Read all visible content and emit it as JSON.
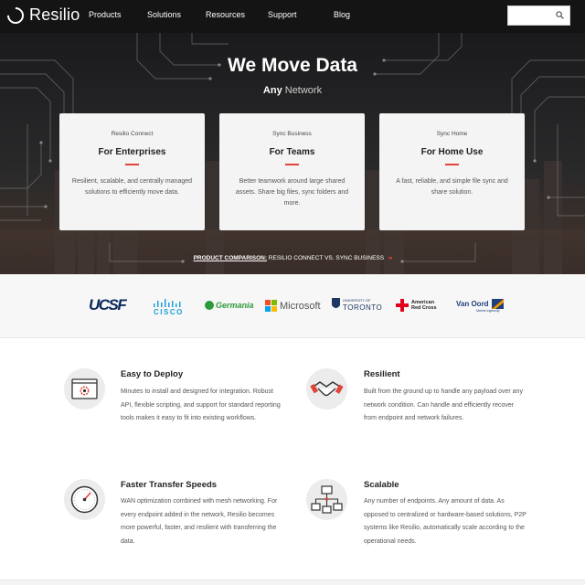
{
  "brand": {
    "name": "Resilio"
  },
  "nav": {
    "items": [
      {
        "label": "Products"
      },
      {
        "label": "Solutions"
      },
      {
        "label": "Resources"
      },
      {
        "label": "Support"
      },
      {
        "label": "Blog"
      }
    ]
  },
  "search": {
    "value": "",
    "placeholder": ""
  },
  "hero": {
    "title": "We Move Data",
    "subtitle_bold": "Any",
    "subtitle_light": "Network"
  },
  "cards": [
    {
      "kicker": "Resilio Connect",
      "title": "For Enterprises",
      "description": "Resilient, scalable, and centrally managed solutions to efficiently move data."
    },
    {
      "kicker": "Sync Business",
      "title": "For Teams",
      "description": "Better teamwork around large shared assets. Share big files, sync folders and more."
    },
    {
      "kicker": "Sync Home",
      "title": "For Home Use",
      "description": "A fast, reliable, and simple file sync and share solution."
    }
  ],
  "comparison": {
    "label": "PRODUCT COMPARISON:",
    "text": "RESILIO CONNECT VS. SYNC BUSINESS",
    "arrows": "›››"
  },
  "logos": {
    "ucsf": "UCSF",
    "cisco": "CISCO",
    "germania": "Germania",
    "microsoft": "Microsoft",
    "toronto_small": "UNIVERSITY OF",
    "toronto": "TORONTO",
    "redcross_1": "American",
    "redcross_2": "Red Cross",
    "vanoord": "Van Oord",
    "vanoord_tag": "Marine ingenuity"
  },
  "features": [
    {
      "title": "Easy to Deploy",
      "description": "Minutes to install and designed for integration. Robust API, flexible scripting, and support for standard reporting tools makes it easy to fit into existing workflows.",
      "icon": "gear-window-icon"
    },
    {
      "title": "Resilient",
      "description": "Built from the ground up to handle any payload over any network condition. Can handle and efficiently recover from endpoint and network failures.",
      "icon": "handshake-icon"
    },
    {
      "title": "Faster Transfer Speeds",
      "description": "WAN optimization combined with mesh networking.  For every endpoint added in the network, Resilio becomes more powerful, faster, and resilient with transferring the data.",
      "icon": "speedometer-icon"
    },
    {
      "title": "Scalable",
      "description": "Any number of endpoints. Any amount of data. As opposed to centralized or hardware-based solutions, P2P systems like Resilio, automatically scale according to the operational needs.",
      "icon": "network-icon"
    }
  ],
  "colors": {
    "nav_bg": "#141414",
    "accent_red": "#e0443a",
    "card_bg": "#f4f4f4",
    "cisco_blue": "#1ba0d7",
    "germania_green": "#2e9b3b",
    "ucsf_navy": "#0a2a5c"
  }
}
